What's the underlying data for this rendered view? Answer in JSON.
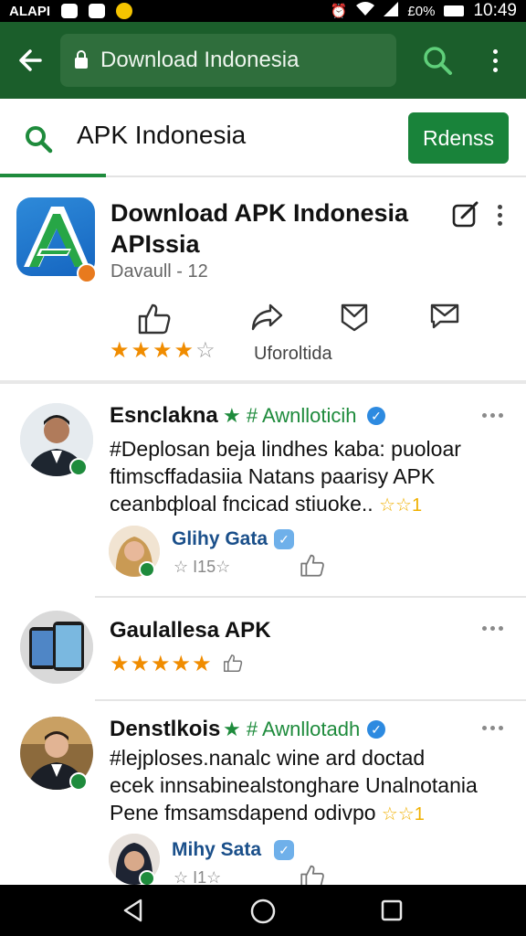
{
  "status_bar": {
    "carrier": "ALAPI",
    "battery": "£0%",
    "time": "10:49"
  },
  "toolbar": {
    "url_text": "Download Indonesia"
  },
  "search": {
    "query": "APK Indonesia",
    "button_label": "Rdenss"
  },
  "app": {
    "title_line1": "Download APK Indonesia",
    "title_line2": "APIssia",
    "subtitle": "Davaull - 12",
    "rating_stars": 4,
    "rating_max": 5,
    "rating_label": "Uforoltida"
  },
  "posts": [
    {
      "author": "Esnclakna",
      "tag": "# Awnlloticih",
      "text_lines": [
        "#Deplosan beja lindhes kaba: puoloar",
        "ftimscffadasiia Natans paarisy APK",
        "ceanbфloal fncicad stiuoke.."
      ],
      "inline_rating": "☆☆☆☆☆",
      "inline_rating_num": "1",
      "reply": {
        "name": "Glihy Gata",
        "meta": "☆ I15☆"
      }
    },
    {
      "author": "Gaulallesa APK",
      "rating_stars": 5
    },
    {
      "author": "Denstlkois",
      "tag": "# Awnllotadh",
      "text_lines": [
        "#lejploses.nanalc wine ard doctad",
        "ecek innsabinealstonghare Unalnotania",
        "Pene fmsamsdapend odivpo"
      ],
      "inline_rating_num": "1",
      "reply": {
        "name": "Mihy Sata",
        "meta": "☆ I1☆"
      }
    }
  ],
  "colors": {
    "toolbar": "#1b5e2b",
    "accent": "#19833a",
    "star": "#f08c00"
  }
}
